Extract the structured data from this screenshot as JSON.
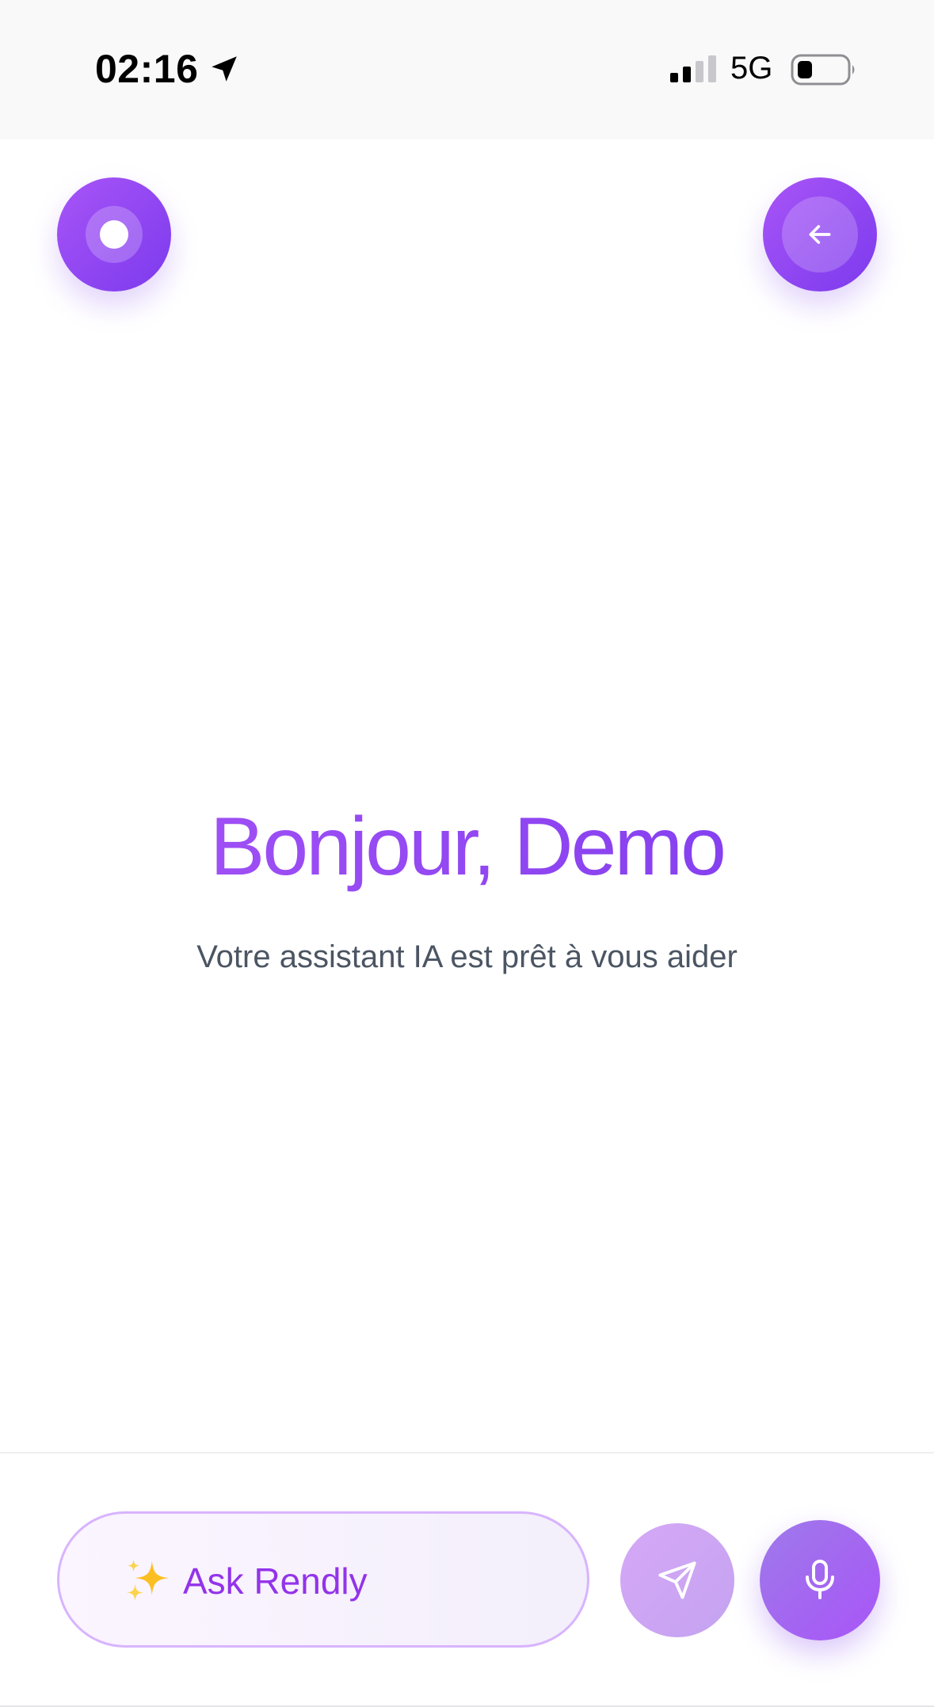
{
  "status_bar": {
    "time": "02:16",
    "network": "5G",
    "icons": [
      "location-arrow-icon",
      "cellular-signal-icon",
      "battery-icon"
    ]
  },
  "header": {
    "left_button_icon": "record-dot-icon",
    "right_button_icon": "arrow-left-icon"
  },
  "main": {
    "greeting": "Bonjour, Demo",
    "subtitle": "Votre assistant IA est prêt à vous aider"
  },
  "composer": {
    "sparkle_icon": "sparkles-icon",
    "placeholder": "Ask Rendly",
    "send_icon": "send-icon",
    "mic_icon": "microphone-icon"
  },
  "colors": {
    "accent": "#a855f7",
    "accent_dark": "#7c3aed",
    "subtitle_text": "#4b5563",
    "ask_text": "#9333ea",
    "ask_border": "#d8b4fe"
  }
}
